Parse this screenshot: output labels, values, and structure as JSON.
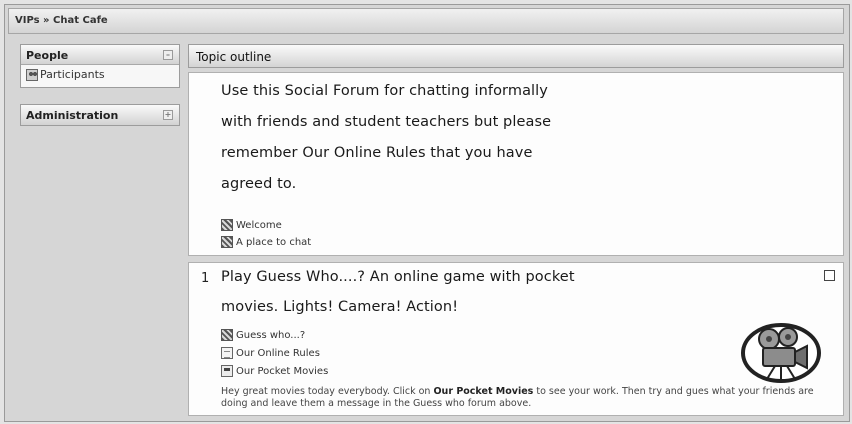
{
  "breadcrumb": {
    "site": "VIPs",
    "separator": " » ",
    "current": "Chat Cafe"
  },
  "blocks": {
    "people": {
      "title": "People",
      "toggle": "–",
      "items": [
        {
          "label": "Participants",
          "icon": "participants-icon"
        }
      ]
    },
    "administration": {
      "title": "Administration",
      "toggle": "+"
    }
  },
  "topic_outline": {
    "title": "Topic outline"
  },
  "section0": {
    "summary_lines": [
      "Use this Social Forum for chatting informally",
      "with friends and student teachers but please",
      "remember Our Online Rules that you have",
      "agreed to."
    ],
    "resources": [
      {
        "label": "Welcome",
        "icon": "forum-icon"
      },
      {
        "label": "A place to chat",
        "icon": "forum-icon"
      }
    ]
  },
  "section1": {
    "number": "1",
    "summary_lines": [
      "Play Guess Who....? An online game with pocket",
      "movies. Lights! Camera! Action!"
    ],
    "resources": [
      {
        "label": "Guess who...?",
        "icon": "forum-icon"
      },
      {
        "label": "Our Online Rules",
        "icon": "page-icon"
      },
      {
        "label": "Our Pocket Movies",
        "icon": "document-icon"
      }
    ],
    "note_before": "Hey great movies today everybody. Click on ",
    "note_bold": "Our Pocket Movies",
    "note_after": " to see your work. Then try and gues what your friends are doing and leave them a message in the Guess who forum above.",
    "image_icon": "movie-camera-icon"
  }
}
